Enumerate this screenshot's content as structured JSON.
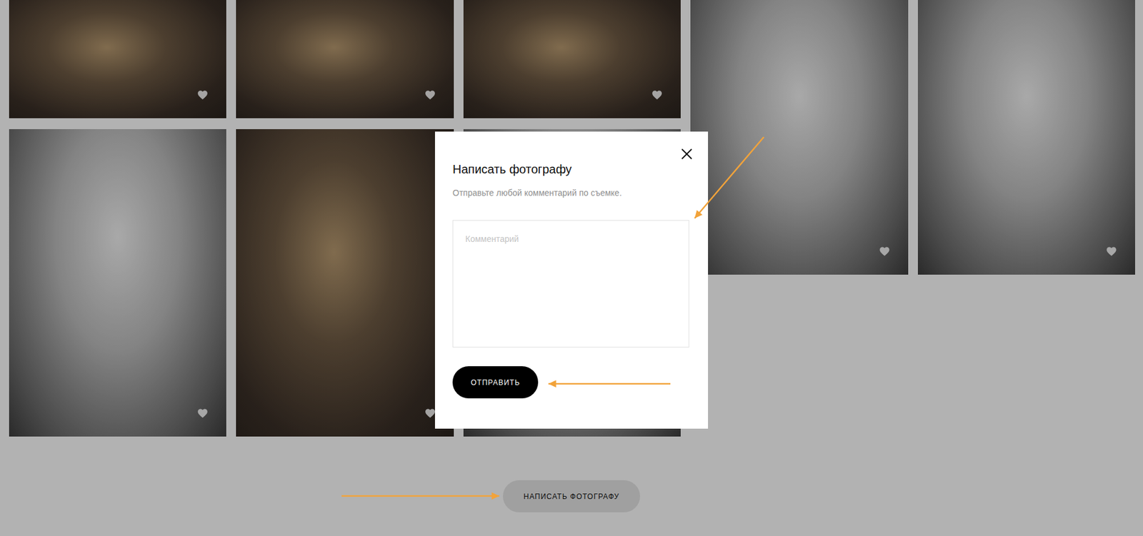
{
  "gallery": {
    "columns": [
      {
        "photos": [
          {
            "kind": "color"
          },
          {
            "kind": "bw"
          }
        ]
      },
      {
        "photos": [
          {
            "kind": "color"
          },
          {
            "kind": "color"
          }
        ]
      },
      {
        "photos": [
          {
            "kind": "color"
          },
          {
            "kind": "bw"
          }
        ]
      },
      {
        "photos": [
          {
            "kind": "bw"
          }
        ]
      },
      {
        "photos": [
          {
            "kind": "bw"
          }
        ]
      }
    ]
  },
  "write_button": "НАПИСАТЬ ФОТОГРАФУ",
  "dialog": {
    "title": "Написать фотографу",
    "subtitle": "Отправьте любой комментарий по съемке.",
    "comment": {
      "placeholder": "Комментарий"
    },
    "submit": "ОТПРАВИТЬ"
  }
}
